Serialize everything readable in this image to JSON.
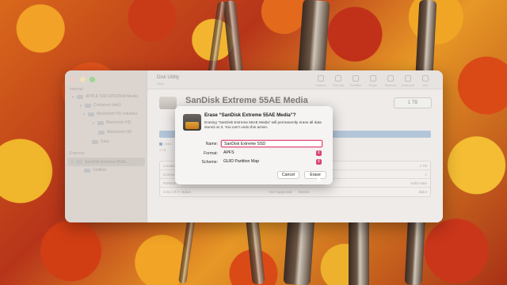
{
  "window": {
    "title": "Disk Utility",
    "subtitle": "View",
    "toolbar": [
      "Volume",
      "First Aid",
      "Partition",
      "Erase",
      "Restore",
      "Unmount",
      "Info"
    ]
  },
  "sidebar": {
    "internal_label": "Internal",
    "external_label": "External",
    "items": [
      {
        "label": "APPLE SSD AP0256M Media",
        "indent": 0
      },
      {
        "label": "Container disk3",
        "indent": 1
      },
      {
        "label": "Macintosh HD volumes",
        "indent": 2
      },
      {
        "label": "Macintosh HD",
        "indent": 3
      },
      {
        "label": "Macintosh HD",
        "indent": 4
      },
      {
        "label": "Data",
        "indent": 3
      }
    ],
    "external_items": [
      {
        "label": "SanDisk Extreme 55AE...",
        "selected": true
      },
      {
        "label": "Untitled",
        "selected": false
      }
    ]
  },
  "disk": {
    "name": "SanDisk Extreme 55AE Media",
    "size": "1 TB",
    "legend_label": "Used",
    "legend_value": "1 TB"
  },
  "info_rows": [
    {
      "k1": "Location",
      "v1": "",
      "k2": "",
      "v2": "1 TB"
    },
    {
      "k1": "Connection",
      "v1": "",
      "k2": "",
      "v2": "1"
    },
    {
      "k1": "Partition Map",
      "v1": "Master Boot Record",
      "k2": "Type",
      "v2": "Solid state"
    },
    {
      "k1": "S.M.A.R.T. status",
      "v1": "Not Supported",
      "k2": "Device",
      "v2": "disk4"
    }
  ],
  "dialog": {
    "title": "Erase “SanDisk Extreme 55AE Media”?",
    "message": "Erasing “SanDisk Extreme 55AE Media” will permanently erase all data stored on it. You can’t undo this action.",
    "name_label": "Name:",
    "name_value": "SanDisk Extreme SSD",
    "format_label": "Format:",
    "format_value": "APFS",
    "scheme_label": "Scheme:",
    "scheme_value": "GUID Partition Map",
    "cancel_label": "Cancel",
    "erase_label": "Erase",
    "accent_color": "#d7457a"
  }
}
